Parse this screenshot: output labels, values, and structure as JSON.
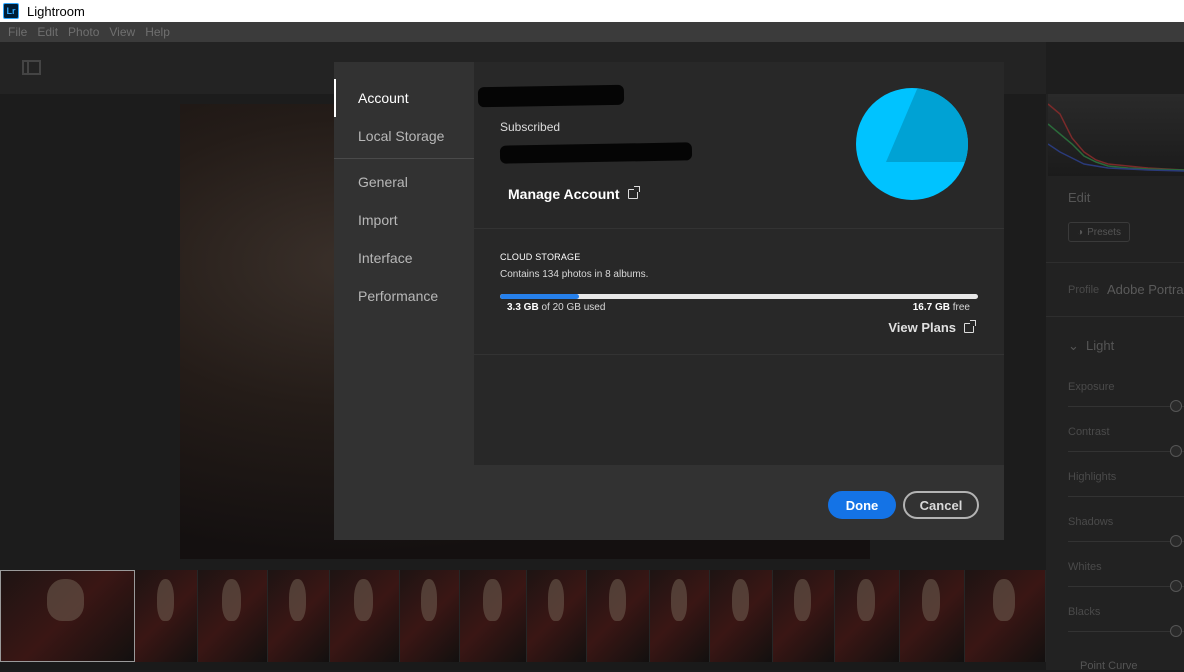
{
  "window": {
    "title": "Lightroom",
    "app_icon": "Lr"
  },
  "menubar": {
    "items": [
      "File",
      "Edit",
      "Photo",
      "View",
      "Help"
    ]
  },
  "dialog": {
    "nav": {
      "items": [
        {
          "label": "Account",
          "active": true
        },
        {
          "label": "Local Storage"
        },
        {
          "label": "General"
        },
        {
          "label": "Import"
        },
        {
          "label": "Interface"
        },
        {
          "label": "Performance"
        }
      ]
    },
    "account": {
      "status": "Subscribed",
      "manage_label": "Manage Account",
      "avatar_color": "#00c3ff"
    },
    "cloud_storage": {
      "title": "CLOUD STORAGE",
      "description": "Contains 134 photos in 8 albums.",
      "used_amount": "3.3 GB",
      "used_suffix": " of 20 GB used",
      "used_fraction": 0.165,
      "free_amount": "16.7 GB",
      "free_suffix": " free",
      "view_plans_label": "View Plans",
      "bar_color": "#2680eb"
    },
    "buttons": {
      "done": "Done",
      "cancel": "Cancel"
    }
  },
  "edit_panel": {
    "title": "Edit",
    "presets_label": "Presets",
    "profile_label": "Profile",
    "profile_value": "Adobe Portra",
    "light_label": "Light",
    "sliders": [
      "Exposure",
      "Contrast",
      "Highlights",
      "Shadows",
      "Whites",
      "Blacks"
    ],
    "point_curve_label": "Point Curve"
  },
  "filmstrip": {
    "count": 15
  }
}
